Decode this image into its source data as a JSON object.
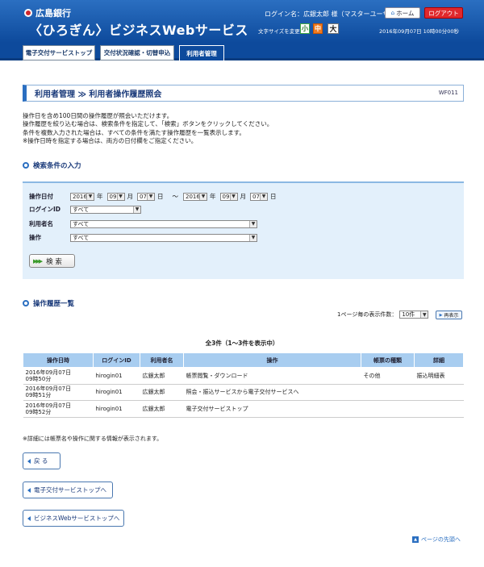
{
  "header": {
    "bank_name": "広島銀行",
    "service_name": "〈ひろぎん〉ビジネスWebサービス",
    "login_name": "ログイン名：広銀太郎 様（マスターユーザ）",
    "home_label": "ホーム",
    "logout_label": "ログアウト",
    "fontsize_label": "文字サイズを変更",
    "fontsize_small": "小",
    "fontsize_mid": "中",
    "fontsize_large": "大",
    "datetime": "2016年09月07日 10時00分00秒"
  },
  "nav": {
    "tabs": [
      {
        "label": "電子交付サービストップ"
      },
      {
        "label": "交付状況確認・切替申込"
      },
      {
        "label": "利用者管理"
      }
    ]
  },
  "page": {
    "title": "利用者管理 ≫ 利用者操作履歴照会",
    "screen_id": "WF011",
    "intro": [
      "操作日を含め100日間の操作履歴が照会いただけます。",
      "操作履歴を絞り込む場合は、検索条件を指定して、「検索」ボタンをクリックしてください。",
      "条件を複数入力された場合は、すべての条件を満たす操作履歴を一覧表示します。",
      "※操作日時を指定する場合は、両方の日付欄をご指定ください。"
    ]
  },
  "search": {
    "heading": "検索条件の入力",
    "date_label": "操作日付",
    "from_year": "2016",
    "from_month": "09",
    "from_day": "07",
    "to_year": "2016",
    "to_month": "09",
    "to_day": "07",
    "unit_year": "年",
    "unit_month": "月",
    "unit_day": "日",
    "tilde": "～",
    "login_label": "ログインID",
    "login_value": "すべて",
    "user_label": "利用者名",
    "user_value": "すべて",
    "op_label": "操作",
    "op_value": "すべて",
    "button": "検 索"
  },
  "results": {
    "heading": "操作履歴一覧",
    "per_page_label": "1ページ毎の表示件数：",
    "per_page_value": "10件",
    "redisplay": "再表示",
    "count_text": "全3件（1～3件を表示中）",
    "columns": [
      "操作日時",
      "ログインID",
      "利用者名",
      "操作",
      "帳票の種類",
      "詳細"
    ],
    "rows": [
      {
        "date": "2016年09月07日",
        "time": "09時50分",
        "login": "hirogin01",
        "user": "広銀太郎",
        "op": "帳票閲覧・ダウンロード",
        "type": "その他",
        "detail": "振込明細表"
      },
      {
        "date": "2016年09月07日",
        "time": "09時51分",
        "login": "hirogin01",
        "user": "広銀太郎",
        "op": "照会・振込サービスから電子交付サービスへ",
        "type": "",
        "detail": ""
      },
      {
        "date": "2016年09月07日",
        "time": "09時52分",
        "login": "hirogin01",
        "user": "広銀太郎",
        "op": "電子交付サービストップ",
        "type": "",
        "detail": ""
      }
    ],
    "note": "※詳細には帳票名や操作に関する情報が表示されます。"
  },
  "footer": {
    "back": "戻 る",
    "to_denshi": "電子交付サービストップへ",
    "to_bizweb": "ビジネスWebサービストップへ",
    "to_top": "ページの先頭へ"
  }
}
